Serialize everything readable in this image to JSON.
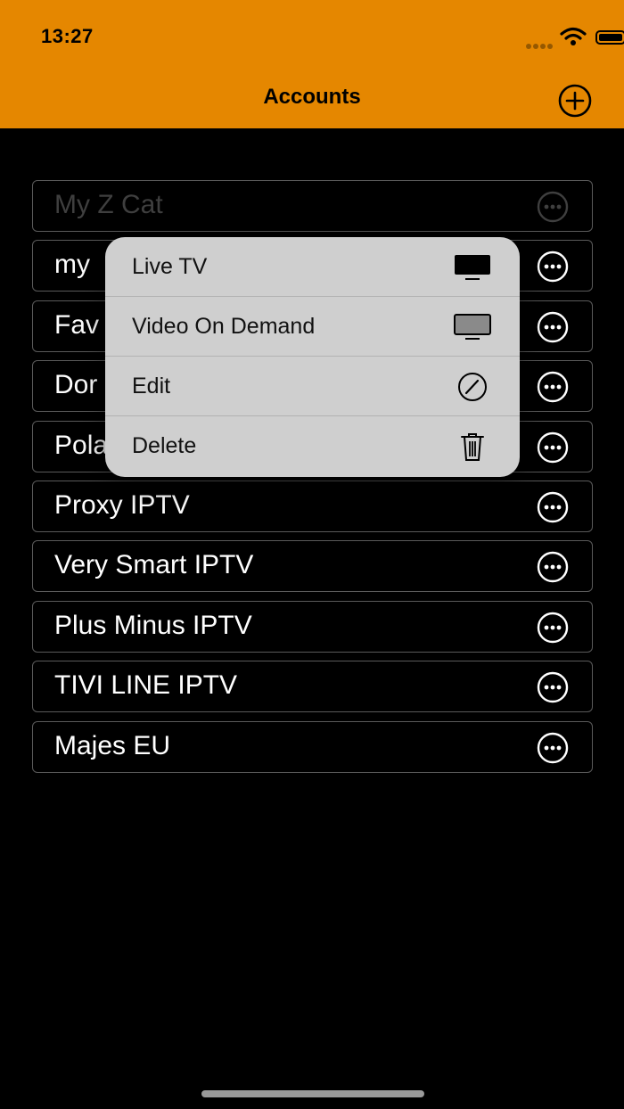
{
  "status_bar": {
    "time": "13:27"
  },
  "nav": {
    "title": "Accounts"
  },
  "accounts": [
    {
      "label": "My Z Cat"
    },
    {
      "label": "my"
    },
    {
      "label": "Fav"
    },
    {
      "label": "Dor"
    },
    {
      "label": "Pola"
    },
    {
      "label": "Proxy IPTV"
    },
    {
      "label": "Very Smart IPTV"
    },
    {
      "label": "Plus Minus IPTV"
    },
    {
      "label": "TIVI LINE IPTV"
    },
    {
      "label": "Majes EU"
    }
  ],
  "context_menu": {
    "items": [
      {
        "label": "Live TV",
        "icon": "tv-icon"
      },
      {
        "label": "Video On Demand",
        "icon": "monitor-icon"
      },
      {
        "label": "Edit",
        "icon": "pencil-icon"
      },
      {
        "label": "Delete",
        "icon": "trash-icon"
      }
    ]
  },
  "colors": {
    "header": "#e58700",
    "background": "#000000",
    "menu": "#cfcfcf"
  }
}
